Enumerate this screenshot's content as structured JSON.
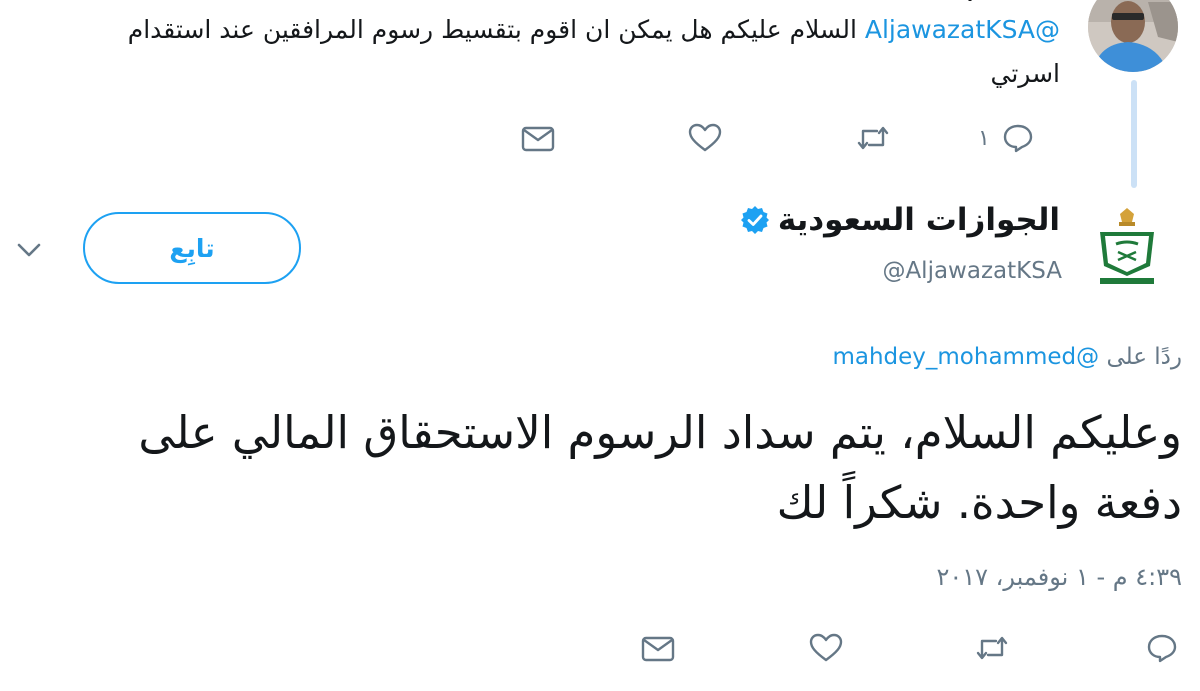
{
  "parent_tweet": {
    "mention": "@AljawazatKSA",
    "text": "السلام عليكم هل يمكن ان اقوم بتقسيط رسوم المرافقين عند استقدام اسرتي",
    "reply_count": "١"
  },
  "author": {
    "name": "الجوازات السعودية",
    "handle": "@AljawazatKSA",
    "follow_label": "تابِع"
  },
  "reply_to": {
    "prefix": "ردًا على",
    "mention": "@mahdey_mohammed"
  },
  "tweet": {
    "text": "وعليكم السلام، يتم سداد الرسوم الاستحقاق المالي على دفعة واحدة. شكراً لك",
    "timestamp": "٤:٣٩ م - ١ نوفمبر، ٢٠١٧"
  },
  "icons": {
    "reply": "reply-icon",
    "retweet": "retweet-icon",
    "like": "heart-icon",
    "message": "envelope-icon",
    "verified": "verified-badge-icon",
    "menu": "chevron-down-icon"
  },
  "colors": {
    "accent": "#1da1f2",
    "link": "#1b95e0",
    "muted": "#657786",
    "thread_line": "#cce1f6",
    "text": "#14171a"
  }
}
